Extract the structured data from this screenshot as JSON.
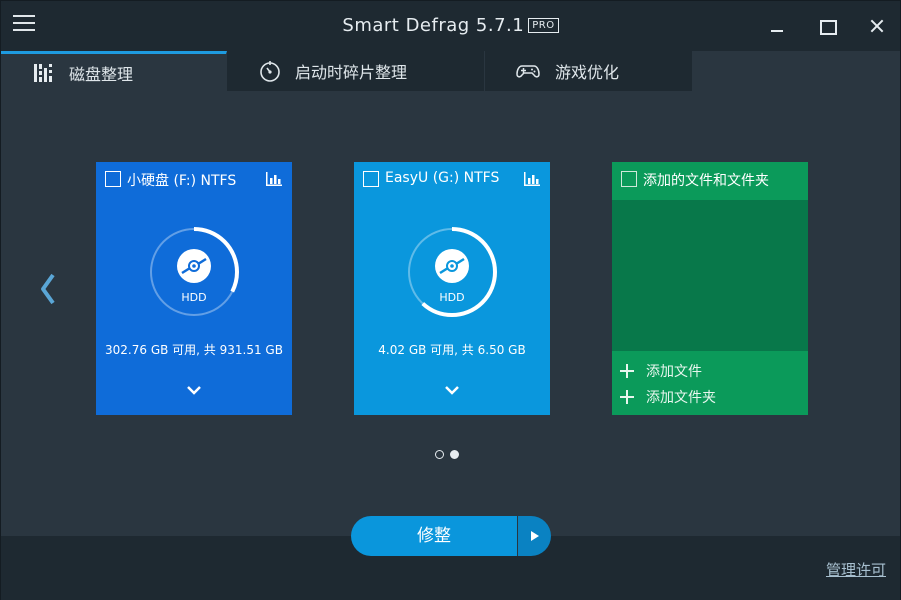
{
  "titlebar": {
    "title": "Smart Defrag 5.7.1",
    "badge": "PRO",
    "menu_icon": "hamburger-menu-icon",
    "minimize_icon": "minimize-icon",
    "maximize_icon": "maximize-icon",
    "close_icon": "close-icon"
  },
  "tabs": [
    {
      "label": "磁盘整理",
      "icon": "disk-defrag-icon",
      "active": true
    },
    {
      "label": "启动时碎片整理",
      "icon": "boot-time-icon",
      "active": false
    },
    {
      "label": "游戏优化",
      "icon": "gamepad-icon",
      "active": false
    }
  ],
  "carousel": {
    "prev_icon": "chevron-left-icon",
    "pages": 2,
    "current_page": 2
  },
  "drives": [
    {
      "name": "小硬盘 (F:) NTFS",
      "type": "HDD",
      "space": "302.76 GB 可用, 共 931.51 GB",
      "free_fraction": 0.325,
      "color": "#0f6cd9"
    },
    {
      "name": "EasyU (G:) NTFS",
      "type": "HDD",
      "space": "4.02 GB 可用, 共 6.50 GB",
      "free_fraction": 0.618,
      "color": "#0a97dd"
    }
  ],
  "files_card": {
    "title": "添加的文件和文件夹",
    "add_file": "添加文件",
    "add_folder": "添加文件夹",
    "color": "#0b9a5a"
  },
  "actions": {
    "defrag_label": "修整",
    "license_link": "管理许可"
  },
  "colors": {
    "accent": "#1e9be0",
    "background": "#2a3640",
    "titlebar": "#1e2931"
  }
}
